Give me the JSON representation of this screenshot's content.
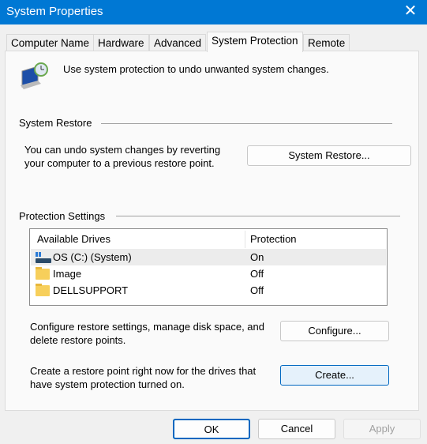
{
  "window": {
    "title": "System Properties",
    "accent": "#0078d4"
  },
  "tabs": [
    {
      "label": "Computer Name"
    },
    {
      "label": "Hardware"
    },
    {
      "label": "Advanced"
    },
    {
      "label": "System Protection",
      "active": true
    },
    {
      "label": "Remote"
    }
  ],
  "intro": "Use system protection to undo unwanted system changes.",
  "restore": {
    "group": "System Restore",
    "text1": "You can undo system changes by reverting",
    "text2": "your computer to a previous restore point.",
    "button": "System Restore..."
  },
  "protection": {
    "group": "Protection Settings",
    "columns": [
      "Available Drives",
      "Protection"
    ],
    "drives": [
      {
        "name": "OS (C:) (System)",
        "status": "On",
        "icon": "system-drive-icon"
      },
      {
        "name": "Image",
        "status": "Off",
        "icon": "folder-icon"
      },
      {
        "name": "DELLSUPPORT",
        "status": "Off",
        "icon": "folder-icon"
      }
    ],
    "configure_text1": "Configure restore settings, manage disk space, and",
    "configure_text2": "delete restore points.",
    "configure_button": "Configure...",
    "create_text1": "Create a restore point right now for the drives that",
    "create_text2": "have system protection turned on.",
    "create_button": "Create..."
  },
  "footer": {
    "ok": "OK",
    "cancel": "Cancel",
    "apply": "Apply"
  }
}
